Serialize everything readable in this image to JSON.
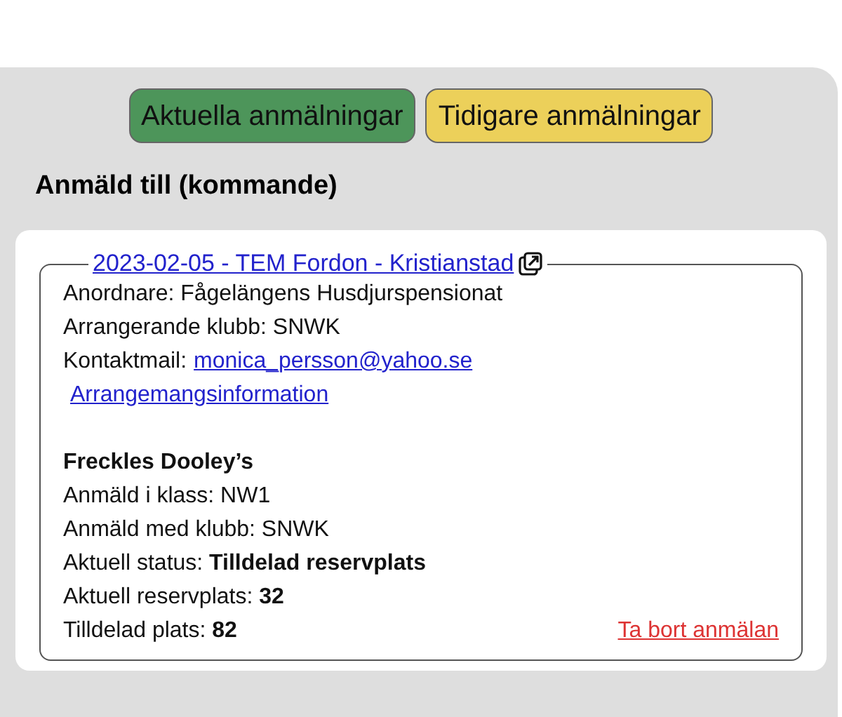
{
  "tabs": [
    {
      "label": "Aktuella anmälningar",
      "selected": true
    },
    {
      "label": "Tidigare anmälningar",
      "selected": false
    }
  ],
  "heading": "Anmäld till (kommande)",
  "entry": {
    "title": "2023-02-05 - TEM Fordon - Kristianstad",
    "lines": [
      "Anordnare: Fågelängens Husdjurspensionat",
      "Arrangerande klubb: SNWK"
    ],
    "contact": {
      "label": "Kontaktmail:",
      "email": "monica_persson@yahoo.se"
    },
    "info_link": "Arrangemangsinformation",
    "dog": "Freckles Dooley’s",
    "details": [
      "Anmäld i klass: NW1",
      "Anmäld med klubb: SNWK",
      "Aktuell status: **Tilldelad reservplats**",
      "Aktuell reservplats: **32**",
      "Tilldelad plats: **82**"
    ],
    "remove": "Ta bort anmälan"
  }
}
